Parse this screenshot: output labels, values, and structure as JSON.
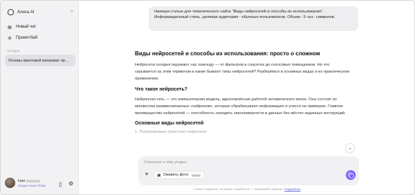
{
  "sidebar": {
    "brand": "Алиса AI",
    "collapse_icon": "collapse-sidebar-icon",
    "new_chat": "Новый чат",
    "prompt_bank": "Промптбаб",
    "section_label": "Сегодня",
    "chats": [
      {
        "title": "Основы квантовой механики: пр..."
      }
    ],
    "user": {
      "name": "Ivan",
      "subtitle": "Опции Алиса Плюс"
    }
  },
  "main": {
    "user_message": "Напиши статью для тематического сайта \"Виды нейросетей и способы их использования\". Информационный стиль, целевая аудитория - обычные пользователи. Объем - 5 тыс. символов.",
    "answer": {
      "title": "Виды нейросетей и способы их использования: просто о сложном",
      "intro": "Нейросети сегодня окружают нас повсюду — от фильтров в соцсетях до голосовых помощников. Но что скрывается за этим термином и какие бывают типы нейросетей? Разберёмся в основных видах и их практическом применении.",
      "h2_what": "Что такое нейросеть?",
      "what_text": "Нейронная сеть — это компьютерная модель, вдохновлённая работой человеческого мозга. Она состоит из множества взаимосвязанных «нейронов», которые обрабатывают информацию и учатся на примерах. Главное преимущество нейросетей — способность находить закономерности в данных без жёстко заданных инструкций.",
      "h2_types": "Основные виды нейросетей",
      "next_line": "1. Полносвязные (простые) нейросети"
    },
    "composer": {
      "placeholder": "Спросите о чём угодно",
      "chip_label": "Оживить фото",
      "chip_badge": "Скоро"
    },
    "disclaimer": "Алиса старается, но может ошибаться — проверяйте важное.",
    "disclaimer_link": "Подробнее"
  }
}
